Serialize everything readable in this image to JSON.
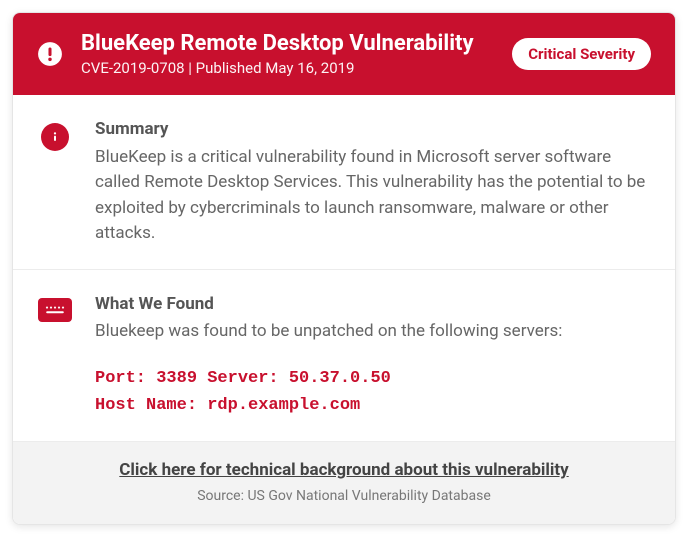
{
  "header": {
    "title": "BlueKeep Remote Desktop Vulnerability",
    "subline": "CVE-2019-0708 | Published May 16, 2019",
    "severity": "Critical Severity"
  },
  "summary": {
    "heading": "Summary",
    "body": "BlueKeep is a critical vulnerability found in Microsoft server software called Remote Desktop Services. This vulnerability has the potential to be exploited by cybercriminals to launch ransomware, malware or other attacks."
  },
  "found": {
    "heading": "What We Found",
    "body": "Bluekeep was found to be unpatched on the following servers:",
    "detail_line1": "Port: 3389 Server: 50.37.0.50",
    "detail_line2": "Host Name: rdp.example.com"
  },
  "footer": {
    "link_text": "Click here for technical background about this vulnerability",
    "source": "Source: US Gov National Vulnerability Database"
  }
}
